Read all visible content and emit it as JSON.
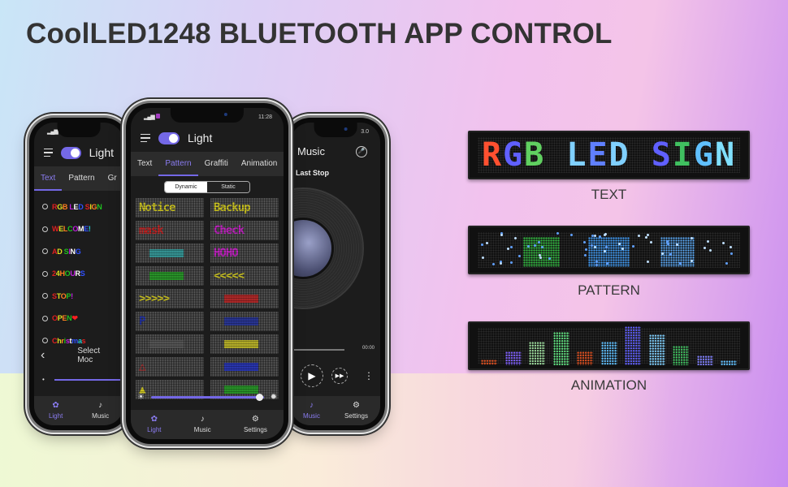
{
  "title": "CoolLED1248 BLUETOOTH APP CONTROL",
  "phone_left": {
    "toggle_on": true,
    "app_title": "Light",
    "tabs": [
      {
        "label": "Text",
        "active": true
      },
      {
        "label": "Pattern",
        "active": false
      },
      {
        "label": "Gr",
        "active": false
      }
    ],
    "text_items": [
      {
        "label": "RGB LED SIGN"
      },
      {
        "label": "WELCOME!"
      },
      {
        "label": "AD SING"
      },
      {
        "label": "24HOURS"
      },
      {
        "label": "STOP!"
      },
      {
        "label": "OPEN❤"
      },
      {
        "label": "Christmas"
      }
    ],
    "select_mode_label": "Select Moc",
    "nav": [
      {
        "label": "Light",
        "icon": "light-icon",
        "active": true
      },
      {
        "label": "Music",
        "icon": "music-icon",
        "active": false
      }
    ]
  },
  "phone_center": {
    "status_time": "11:28",
    "toggle_on": true,
    "app_title": "Light",
    "tabs": [
      {
        "label": "Text",
        "active": false
      },
      {
        "label": "Pattern",
        "active": true
      },
      {
        "label": "Graffiti",
        "active": false
      },
      {
        "label": "Animation",
        "active": false
      }
    ],
    "segment": {
      "dynamic": "Dynamic",
      "static": "Static",
      "selected": "Dynamic"
    },
    "patterns": [
      {
        "text": "Notice",
        "color": "#c8c020"
      },
      {
        "text": "Backup",
        "color": "#c8c020"
      },
      {
        "text": "mask",
        "color": "#c02020"
      },
      {
        "text": "Check",
        "color": "#c020c0"
      },
      {
        "text": "",
        "color": "#30a0a0"
      },
      {
        "text": "HOHO",
        "color": "#c020c0"
      },
      {
        "text": "",
        "color": "#20a020"
      },
      {
        "text": "<<<<<",
        "color": "#c8c020"
      },
      {
        "text": ">>>>>",
        "color": "#c8c020"
      },
      {
        "text": "",
        "color": "#c02020"
      },
      {
        "text": "P",
        "color": "#2030a0"
      },
      {
        "text": "",
        "color": "#2030a0"
      },
      {
        "text": "",
        "color": "#555555"
      },
      {
        "text": "",
        "color": "#c8c020"
      },
      {
        "text": "△",
        "color": "#c02020"
      },
      {
        "text": "",
        "color": "#2030c0"
      },
      {
        "text": "▲",
        "color": "#c8c020"
      },
      {
        "text": "",
        "color": "#20a020"
      }
    ],
    "brightness": 0.97,
    "nav": [
      {
        "label": "Light",
        "icon": "light-icon",
        "active": true
      },
      {
        "label": "Music",
        "icon": "music-icon",
        "active": false
      },
      {
        "label": "Settings",
        "icon": "settings-icon",
        "active": false
      }
    ]
  },
  "phone_right": {
    "status_time": "3.0",
    "app_title": "Music",
    "song": "Last Stop",
    "time": "00:00",
    "nav": [
      {
        "label": "Music",
        "icon": "music-icon",
        "active": true
      },
      {
        "label": "Settings",
        "icon": "settings-icon",
        "active": false
      }
    ]
  },
  "signs": [
    {
      "label": "TEXT",
      "display": "RGB LED SIGN"
    },
    {
      "label": "PATTERN",
      "display": ""
    },
    {
      "label": "ANIMATION",
      "display": "",
      "bars": [
        {
          "level": 0.15,
          "color": "#e05020"
        },
        {
          "level": 0.35,
          "color": "#8060ff"
        },
        {
          "level": 0.6,
          "color": "#a0e0a0"
        },
        {
          "level": 0.85,
          "color": "#60e080"
        },
        {
          "level": 0.35,
          "color": "#e05020"
        },
        {
          "level": 0.6,
          "color": "#60c0ff"
        },
        {
          "level": 1.0,
          "color": "#6060ff"
        },
        {
          "level": 0.8,
          "color": "#80d0ff"
        },
        {
          "level": 0.5,
          "color": "#40c060"
        },
        {
          "level": 0.25,
          "color": "#8080ff"
        },
        {
          "level": 0.12,
          "color": "#60c0ff"
        }
      ]
    }
  ],
  "colors": {
    "accent": "#7468e6",
    "text_dark": "#333333"
  }
}
